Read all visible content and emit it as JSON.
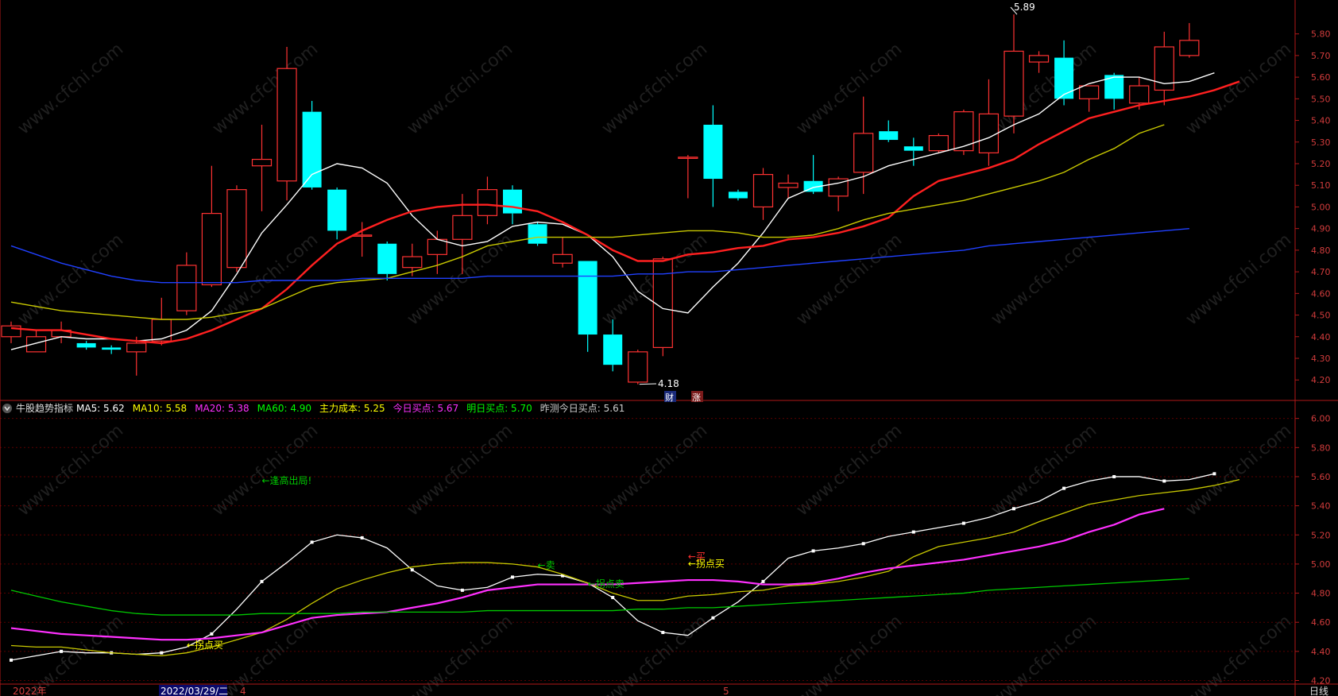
{
  "colors": {
    "background": "#000000",
    "up": "#ff3232",
    "down": "#00ffff",
    "frame": "#b01818",
    "grid": "#5a0000",
    "axis_text": "#d23c3c",
    "ma5": "#ffffff",
    "ma10": "#ff2020",
    "ma20": "#c8c800",
    "ma60": "#2040ff",
    "ind_white": "#ffffff",
    "ind_yellow": "#c8c800",
    "ind_magenta": "#ff30ff",
    "ind_green": "#00c800",
    "watermark": "#1f1f1f"
  },
  "watermark": "www.cfchi.com",
  "header": {
    "icon": "chevron-down-icon",
    "name": "牛股趋势指标",
    "items": [
      {
        "label": "MA5:",
        "value": "5.62",
        "color": "#ffffff"
      },
      {
        "label": "MA10:",
        "value": "5.58",
        "color": "#ffff00"
      },
      {
        "label": "MA20:",
        "value": "5.38",
        "color": "#ff30ff"
      },
      {
        "label": "MA60:",
        "value": "4.90",
        "color": "#00ff00"
      },
      {
        "label": "主力成本:",
        "value": "5.25",
        "color": "#ffff00"
      },
      {
        "label": "今日买点:",
        "value": "5.67",
        "color": "#ff30ff"
      },
      {
        "label": "明日买点:",
        "value": "5.70",
        "color": "#00ff00"
      },
      {
        "label": "昨测今日买点:",
        "value": "5.61",
        "color": "#cccccc"
      }
    ]
  },
  "bottom_bar": {
    "year": "2022年",
    "date": "2022/03/29/二",
    "month4": "4",
    "month5": "5",
    "period": "日线"
  },
  "price_labels": {
    "high": "5.89",
    "low": "4.18",
    "badge_cai": "财",
    "badge_zhang": "涨"
  },
  "annotations": [
    {
      "text": "←逢高出局!",
      "color": "#00cc00",
      "x": 10,
      "y": 5.55
    },
    {
      "text": "←卖",
      "color": "#00cc00",
      "x": 21,
      "y": 4.97
    },
    {
      "text": "←拐点卖",
      "color": "#00cc00",
      "x": 23,
      "y": 4.84
    },
    {
      "text": "←买",
      "color": "#ff3030",
      "x": 27,
      "y": 5.03
    },
    {
      "text": "←拐点买",
      "color": "#ffff00",
      "x": 27,
      "y": 4.98
    },
    {
      "text": "←拐点买",
      "color": "#ffff00",
      "x": 7,
      "y": 4.42
    }
  ],
  "chart_data": [
    {
      "type": "candlestick",
      "ylim": [
        4.12,
        5.92
      ],
      "ticks": [
        "5.80",
        "5.70",
        "5.60",
        "5.50",
        "5.40",
        "5.30",
        "5.20",
        "5.10",
        "5.00",
        "4.90",
        "4.80",
        "4.70",
        "4.60",
        "4.50",
        "4.40",
        "4.30",
        "4.20"
      ],
      "candles": [
        {
          "o": 4.4,
          "h": 4.47,
          "l": 4.37,
          "c": 4.45
        },
        {
          "o": 4.33,
          "h": 4.43,
          "l": 4.33,
          "c": 4.4
        },
        {
          "o": 4.4,
          "h": 4.47,
          "l": 4.37,
          "c": 4.43
        },
        {
          "o": 4.37,
          "h": 4.38,
          "l": 4.34,
          "c": 4.35
        },
        {
          "o": 4.35,
          "h": 4.36,
          "l": 4.32,
          "c": 4.34
        },
        {
          "o": 4.33,
          "h": 4.4,
          "l": 4.22,
          "c": 4.37
        },
        {
          "o": 4.38,
          "h": 4.58,
          "l": 4.36,
          "c": 4.48
        },
        {
          "o": 4.52,
          "h": 4.79,
          "l": 4.5,
          "c": 4.73
        },
        {
          "o": 4.64,
          "h": 5.19,
          "l": 4.63,
          "c": 4.97
        },
        {
          "o": 4.72,
          "h": 5.1,
          "l": 4.7,
          "c": 5.08
        },
        {
          "o": 5.19,
          "h": 5.38,
          "l": 4.98,
          "c": 5.22
        },
        {
          "o": 5.12,
          "h": 5.74,
          "l": 5.03,
          "c": 5.64
        },
        {
          "o": 5.44,
          "h": 5.49,
          "l": 5.08,
          "c": 5.09
        },
        {
          "o": 5.08,
          "h": 5.09,
          "l": 4.85,
          "c": 4.89
        },
        {
          "o": 4.87,
          "h": 4.93,
          "l": 4.77,
          "c": 4.87
        },
        {
          "o": 4.83,
          "h": 4.84,
          "l": 4.66,
          "c": 4.69
        },
        {
          "o": 4.72,
          "h": 4.83,
          "l": 4.68,
          "c": 4.77
        },
        {
          "o": 4.78,
          "h": 4.89,
          "l": 4.69,
          "c": 4.85
        },
        {
          "o": 4.85,
          "h": 5.06,
          "l": 4.69,
          "c": 4.96
        },
        {
          "o": 4.96,
          "h": 5.14,
          "l": 4.92,
          "c": 5.08
        },
        {
          "o": 5.08,
          "h": 5.1,
          "l": 4.92,
          "c": 4.97
        },
        {
          "o": 4.92,
          "h": 4.93,
          "l": 4.82,
          "c": 4.83
        },
        {
          "o": 4.74,
          "h": 4.86,
          "l": 4.72,
          "c": 4.78
        },
        {
          "o": 4.75,
          "h": 4.75,
          "l": 4.33,
          "c": 4.41
        },
        {
          "o": 4.41,
          "h": 4.48,
          "l": 4.24,
          "c": 4.27
        },
        {
          "o": 4.19,
          "h": 4.34,
          "l": 4.18,
          "c": 4.33
        },
        {
          "o": 4.35,
          "h": 4.77,
          "l": 4.31,
          "c": 4.76
        },
        {
          "o": 5.23,
          "h": 5.24,
          "l": 5.04,
          "c": 5.23
        },
        {
          "o": 5.38,
          "h": 5.47,
          "l": 5.0,
          "c": 5.13
        },
        {
          "o": 5.07,
          "h": 5.08,
          "l": 5.03,
          "c": 5.04
        },
        {
          "o": 5.0,
          "h": 5.18,
          "l": 4.94,
          "c": 5.15
        },
        {
          "o": 5.09,
          "h": 5.15,
          "l": 5.04,
          "c": 5.11
        },
        {
          "o": 5.12,
          "h": 5.24,
          "l": 5.06,
          "c": 5.07
        },
        {
          "o": 5.05,
          "h": 5.14,
          "l": 4.98,
          "c": 5.13
        },
        {
          "o": 5.16,
          "h": 5.51,
          "l": 5.06,
          "c": 5.34
        },
        {
          "o": 5.35,
          "h": 5.4,
          "l": 5.3,
          "c": 5.31
        },
        {
          "o": 5.28,
          "h": 5.32,
          "l": 5.19,
          "c": 5.26
        },
        {
          "o": 5.26,
          "h": 5.34,
          "l": 5.25,
          "c": 5.33
        },
        {
          "o": 5.26,
          "h": 5.45,
          "l": 5.24,
          "c": 5.44
        },
        {
          "o": 5.25,
          "h": 5.59,
          "l": 5.19,
          "c": 5.43
        },
        {
          "o": 5.42,
          "h": 5.89,
          "l": 5.34,
          "c": 5.72
        },
        {
          "o": 5.67,
          "h": 5.72,
          "l": 5.62,
          "c": 5.7
        },
        {
          "o": 5.69,
          "h": 5.77,
          "l": 5.47,
          "c": 5.5
        },
        {
          "o": 5.5,
          "h": 5.56,
          "l": 5.44,
          "c": 5.56
        },
        {
          "o": 5.61,
          "h": 5.62,
          "l": 5.45,
          "c": 5.5
        },
        {
          "o": 5.48,
          "h": 5.6,
          "l": 5.45,
          "c": 5.56
        },
        {
          "o": 5.54,
          "h": 5.81,
          "l": 5.47,
          "c": 5.74
        },
        {
          "o": 5.7,
          "h": 5.85,
          "l": 5.69,
          "c": 5.77
        }
      ],
      "ma": [
        {
          "name": "MA5",
          "color": "#ffffff",
          "values": [
            4.34,
            4.37,
            4.4,
            4.39,
            4.39,
            4.38,
            4.39,
            4.43,
            4.52,
            4.69,
            4.88,
            5.01,
            5.15,
            5.2,
            5.18,
            5.11,
            4.96,
            4.85,
            4.82,
            4.84,
            4.91,
            4.93,
            4.92,
            4.87,
            4.77,
            4.61,
            4.53,
            4.51,
            4.63,
            4.74,
            4.88,
            5.04,
            5.09,
            5.11,
            5.14,
            5.19,
            5.22,
            5.25,
            5.28,
            5.32,
            5.38,
            5.43,
            5.52,
            5.57,
            5.6,
            5.6,
            5.57,
            5.58,
            5.62
          ]
        },
        {
          "name": "MA10",
          "color": "#ff2020",
          "values": [
            4.44,
            4.43,
            4.43,
            4.41,
            4.39,
            4.38,
            4.37,
            4.39,
            4.43,
            4.48,
            4.53,
            4.62,
            4.73,
            4.83,
            4.89,
            4.94,
            4.98,
            5.0,
            5.01,
            5.01,
            5.0,
            4.98,
            4.93,
            4.87,
            4.8,
            4.75,
            4.75,
            4.78,
            4.79,
            4.81,
            4.82,
            4.85,
            4.86,
            4.88,
            4.91,
            4.95,
            5.05,
            5.12,
            5.15,
            5.18,
            5.22,
            5.29,
            5.35,
            5.41,
            5.44,
            5.47,
            5.49,
            5.51,
            5.54,
            5.58
          ]
        },
        {
          "name": "MA20",
          "color": "#c8c800",
          "values": [
            4.56,
            4.54,
            4.52,
            4.51,
            4.5,
            4.49,
            4.48,
            4.48,
            4.49,
            4.51,
            4.53,
            4.58,
            4.63,
            4.65,
            4.66,
            4.67,
            4.7,
            4.73,
            4.77,
            4.82,
            4.84,
            4.86,
            4.86,
            4.86,
            4.86,
            4.87,
            4.88,
            4.89,
            4.89,
            4.88,
            4.86,
            4.86,
            4.87,
            4.9,
            4.94,
            4.97,
            4.99,
            5.01,
            5.03,
            5.06,
            5.09,
            5.12,
            5.16,
            5.22,
            5.27,
            5.34,
            5.38
          ]
        },
        {
          "name": "MA60",
          "color": "#2040ff",
          "values": [
            4.82,
            4.78,
            4.74,
            4.71,
            4.68,
            4.66,
            4.65,
            4.65,
            4.65,
            4.65,
            4.66,
            4.66,
            4.66,
            4.66,
            4.67,
            4.67,
            4.67,
            4.67,
            4.67,
            4.68,
            4.68,
            4.68,
            4.68,
            4.68,
            4.68,
            4.69,
            4.69,
            4.7,
            4.7,
            4.71,
            4.72,
            4.73,
            4.74,
            4.75,
            4.76,
            4.77,
            4.78,
            4.79,
            4.8,
            4.82,
            4.83,
            4.84,
            4.85,
            4.86,
            4.87,
            4.88,
            4.89,
            4.9
          ]
        }
      ]
    },
    {
      "type": "line",
      "ylim": [
        4.17,
        6.08
      ],
      "ticks": [
        "6.00",
        "5.80",
        "5.60",
        "5.40",
        "5.20",
        "5.00",
        "4.80",
        "4.60",
        "4.40",
        "4.20"
      ],
      "series": [
        {
          "name": "MA5",
          "color": "#ffffff",
          "values": [
            4.34,
            4.37,
            4.4,
            4.39,
            4.39,
            4.38,
            4.39,
            4.43,
            4.52,
            4.69,
            4.88,
            5.01,
            5.15,
            5.2,
            5.18,
            5.11,
            4.96,
            4.85,
            4.82,
            4.84,
            4.91,
            4.93,
            4.92,
            4.87,
            4.77,
            4.61,
            4.53,
            4.51,
            4.63,
            4.74,
            4.88,
            5.04,
            5.09,
            5.11,
            5.14,
            5.19,
            5.22,
            5.25,
            5.28,
            5.32,
            5.38,
            5.43,
            5.52,
            5.57,
            5.6,
            5.6,
            5.57,
            5.58,
            5.62
          ],
          "markers": true
        },
        {
          "name": "MA10",
          "color": "#c8c800",
          "values": [
            4.44,
            4.43,
            4.43,
            4.41,
            4.39,
            4.38,
            4.37,
            4.39,
            4.43,
            4.48,
            4.53,
            4.62,
            4.73,
            4.83,
            4.89,
            4.94,
            4.98,
            5.0,
            5.01,
            5.01,
            5.0,
            4.98,
            4.93,
            4.87,
            4.8,
            4.75,
            4.75,
            4.78,
            4.79,
            4.81,
            4.82,
            4.85,
            4.86,
            4.88,
            4.91,
            4.95,
            5.05,
            5.12,
            5.15,
            5.18,
            5.22,
            5.29,
            5.35,
            5.41,
            5.44,
            5.47,
            5.49,
            5.51,
            5.54,
            5.58
          ]
        },
        {
          "name": "MA20",
          "color": "#ff30ff",
          "values": [
            4.56,
            4.54,
            4.52,
            4.51,
            4.5,
            4.49,
            4.48,
            4.48,
            4.49,
            4.51,
            4.53,
            4.58,
            4.63,
            4.65,
            4.66,
            4.67,
            4.7,
            4.73,
            4.77,
            4.82,
            4.84,
            4.86,
            4.86,
            4.86,
            4.86,
            4.87,
            4.88,
            4.89,
            4.89,
            4.88,
            4.86,
            4.86,
            4.87,
            4.9,
            4.94,
            4.97,
            4.99,
            5.01,
            5.03,
            5.06,
            5.09,
            5.12,
            5.16,
            5.22,
            5.27,
            5.34,
            5.38
          ]
        },
        {
          "name": "MA60",
          "color": "#00c800",
          "values": [
            4.82,
            4.78,
            4.74,
            4.71,
            4.68,
            4.66,
            4.65,
            4.65,
            4.65,
            4.65,
            4.66,
            4.66,
            4.66,
            4.66,
            4.67,
            4.67,
            4.67,
            4.67,
            4.67,
            4.68,
            4.68,
            4.68,
            4.68,
            4.68,
            4.68,
            4.69,
            4.69,
            4.7,
            4.7,
            4.71,
            4.72,
            4.73,
            4.74,
            4.75,
            4.76,
            4.77,
            4.78,
            4.79,
            4.8,
            4.82,
            4.83,
            4.84,
            4.85,
            4.86,
            4.87,
            4.88,
            4.89,
            4.9
          ]
        }
      ]
    }
  ]
}
